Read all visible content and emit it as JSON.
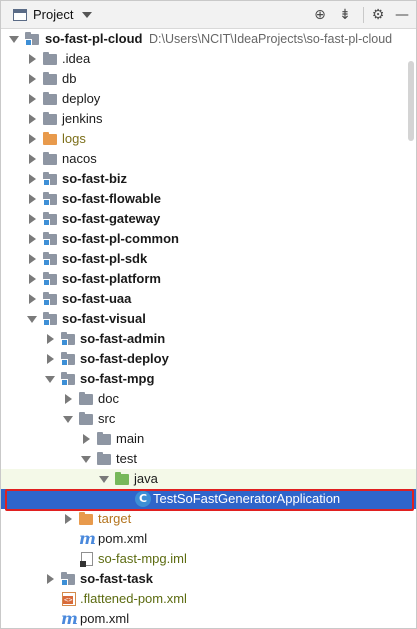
{
  "panel": {
    "title": "Project",
    "buttons": [
      {
        "icon": "crosshair-icon",
        "glyph": "⊕"
      },
      {
        "icon": "collapse-all-icon",
        "glyph": "⇟"
      },
      {
        "icon": "gear-icon",
        "glyph": "⚙"
      },
      {
        "icon": "hide-icon",
        "glyph": "—"
      }
    ]
  },
  "tree": {
    "root": {
      "label": "so-fast-pl-cloud",
      "path": "D:\\Users\\NCIT\\IdeaProjects\\so-fast-pl-cloud"
    },
    "items": [
      {
        "label": ".idea"
      },
      {
        "label": "db"
      },
      {
        "label": "deploy"
      },
      {
        "label": "jenkins"
      },
      {
        "label": "logs"
      },
      {
        "label": "nacos"
      },
      {
        "label": "so-fast-biz"
      },
      {
        "label": "so-fast-flowable"
      },
      {
        "label": "so-fast-gateway"
      },
      {
        "label": "so-fast-pl-common"
      },
      {
        "label": "so-fast-pl-sdk"
      },
      {
        "label": "so-fast-platform"
      },
      {
        "label": "so-fast-uaa"
      },
      {
        "label": "so-fast-visual"
      },
      {
        "label": "so-fast-admin"
      },
      {
        "label": "so-fast-deploy"
      },
      {
        "label": "so-fast-mpg"
      },
      {
        "label": "doc"
      },
      {
        "label": "src"
      },
      {
        "label": "main"
      },
      {
        "label": "test"
      },
      {
        "label": "java"
      },
      {
        "label": "TestSoFastGeneratorApplication"
      },
      {
        "label": "target"
      },
      {
        "label": "pom.xml"
      },
      {
        "label": "so-fast-mpg.iml"
      },
      {
        "label": "so-fast-task"
      },
      {
        "label": ".flattened-pom.xml"
      },
      {
        "label": "pom.xml"
      }
    ]
  },
  "colors": {
    "selection": "#2f65ca",
    "selection_outline": "#e02020",
    "test_band": "#f4f9e8",
    "folder": "#8e96a3",
    "module_badge": "#3d8fd6"
  }
}
